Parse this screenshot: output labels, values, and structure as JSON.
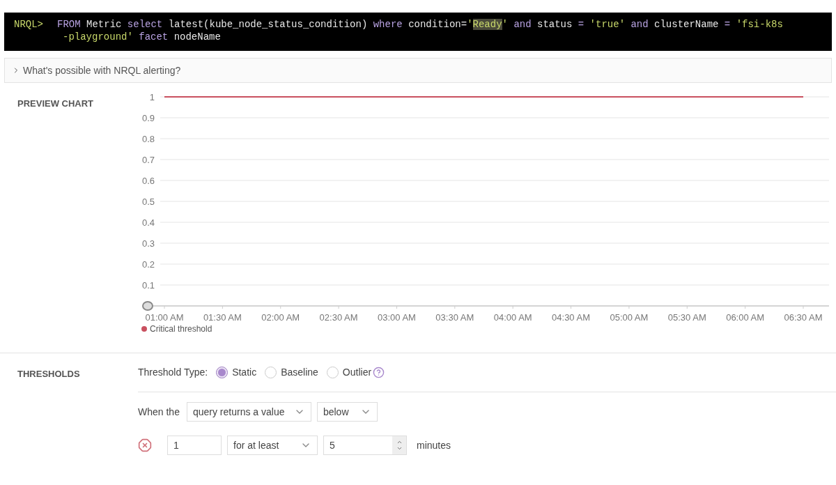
{
  "query": {
    "prompt": "NRQL>",
    "lines": [
      [
        {
          "kind": "kw",
          "text": "FROM"
        },
        {
          "kind": "plain",
          "text": " Metric "
        },
        {
          "kind": "kw",
          "text": "select"
        },
        {
          "kind": "plain",
          "text": " latest(kube_node_status_condition) "
        },
        {
          "kind": "kw",
          "text": "where"
        },
        {
          "kind": "plain",
          "text": " condition="
        },
        {
          "kind": "str",
          "text": "'"
        },
        {
          "kind": "match",
          "text": "Ready"
        },
        {
          "kind": "str",
          "text": "'"
        },
        {
          "kind": "kw",
          "text": " and"
        },
        {
          "kind": "plain",
          "text": " status "
        },
        {
          "kind": "op",
          "text": "="
        },
        {
          "kind": "str",
          "text": " 'true'"
        },
        {
          "kind": "kw",
          "text": " and"
        },
        {
          "kind": "plain",
          "text": " clusterName "
        },
        {
          "kind": "op",
          "text": "="
        },
        {
          "kind": "str",
          "text": " 'fsi-k8s"
        }
      ],
      [
        {
          "kind": "str",
          "text": "-playground'"
        },
        {
          "kind": "kw",
          "text": " facet"
        },
        {
          "kind": "plain",
          "text": " nodeName"
        }
      ]
    ]
  },
  "help": {
    "label": "What's possible with NRQL alerting?",
    "expanded": false
  },
  "preview": {
    "label": "PREVIEW CHART",
    "chart_data": {
      "type": "line",
      "categories": [
        "01:00 AM",
        "01:30 AM",
        "02:00 AM",
        "02:30 AM",
        "03:00 AM",
        "03:30 AM",
        "04:00 AM",
        "04:30 AM",
        "05:00 AM",
        "05:30 AM",
        "06:00 AM",
        "06:30 AM"
      ],
      "series": [
        {
          "name": "Critical threshold",
          "color": "#c9505f",
          "values": [
            1,
            1,
            1,
            1,
            1,
            1,
            1,
            1,
            1,
            1,
            1,
            1
          ]
        }
      ],
      "ylim": [
        0,
        1
      ],
      "grid": true,
      "yticks": [
        0.1,
        0.2,
        0.3,
        0.4,
        0.5,
        0.6,
        0.7,
        0.8,
        0.9,
        1
      ]
    }
  },
  "thresholds": {
    "label": "THRESHOLDS",
    "type_label": "Threshold Type:",
    "types": [
      {
        "label": "Static",
        "selected": true
      },
      {
        "label": "Baseline",
        "selected": false
      },
      {
        "label": "Outlier",
        "selected": false
      }
    ],
    "when_label": "When the",
    "condition": "query returns a value",
    "operator": "below",
    "value": "1",
    "duration_mode": "for at least",
    "duration": "5",
    "unit": "minutes"
  }
}
